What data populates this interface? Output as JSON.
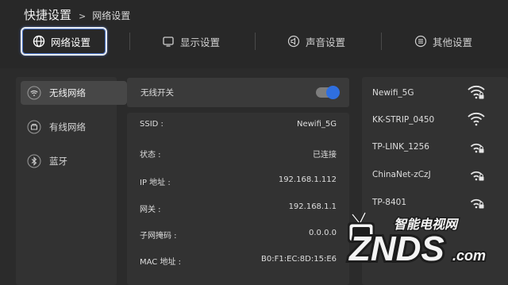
{
  "breadcrumb": {
    "root": "快捷设置",
    "separator": ">",
    "current": "网络设置"
  },
  "tabs": [
    {
      "label": "网络设置",
      "icon": "globe-icon",
      "active": true
    },
    {
      "label": "显示设置",
      "icon": "display-icon",
      "active": false
    },
    {
      "label": "声音设置",
      "icon": "speaker-icon",
      "active": false
    },
    {
      "label": "其他设置",
      "icon": "menu-icon",
      "active": false
    }
  ],
  "sidebar": {
    "items": [
      {
        "label": "无线网络",
        "icon": "wifi-icon",
        "selected": true
      },
      {
        "label": "有线网络",
        "icon": "ethernet-icon",
        "selected": false
      },
      {
        "label": "蓝牙",
        "icon": "bluetooth-icon",
        "selected": false
      }
    ]
  },
  "wireless_switch": {
    "label": "无线开关",
    "on": true
  },
  "connection_info": [
    {
      "key": "SSID :",
      "value": "Newifi_5G"
    },
    {
      "key": "状态 :",
      "value": "已连接"
    },
    {
      "key": "IP 地址 :",
      "value": "192.168.1.112"
    },
    {
      "key": "网关 :",
      "value": "192.168.1.1"
    },
    {
      "key": "子网掩码 :",
      "value": "0.0.0.0"
    },
    {
      "key": "MAC 地址 :",
      "value": "B0:F1:EC:8D:15:E6"
    }
  ],
  "networks": [
    {
      "ssid": "Newifi_5G",
      "locked": true,
      "icon": "wifi-lock-icon"
    },
    {
      "ssid": "KK-STRIP_0450",
      "locked": false,
      "icon": "wifi-icon"
    },
    {
      "ssid": "TP-LINK_1256",
      "locked": true,
      "icon": "wifi-lock-icon"
    },
    {
      "ssid": "ChinaNet-zCzJ",
      "locked": true,
      "icon": "wifi-lock-icon"
    },
    {
      "ssid": "TP-8401",
      "locked": true,
      "icon": "wifi-lock-icon"
    }
  ],
  "watermark": {
    "top_text": "智能电视网",
    "main_text": "ZNDS",
    "suffix": ".com"
  },
  "colors": {
    "accent": "#2f6fe0",
    "background": "#2b2b2b",
    "panel": "#323232",
    "selected": "#474747"
  }
}
